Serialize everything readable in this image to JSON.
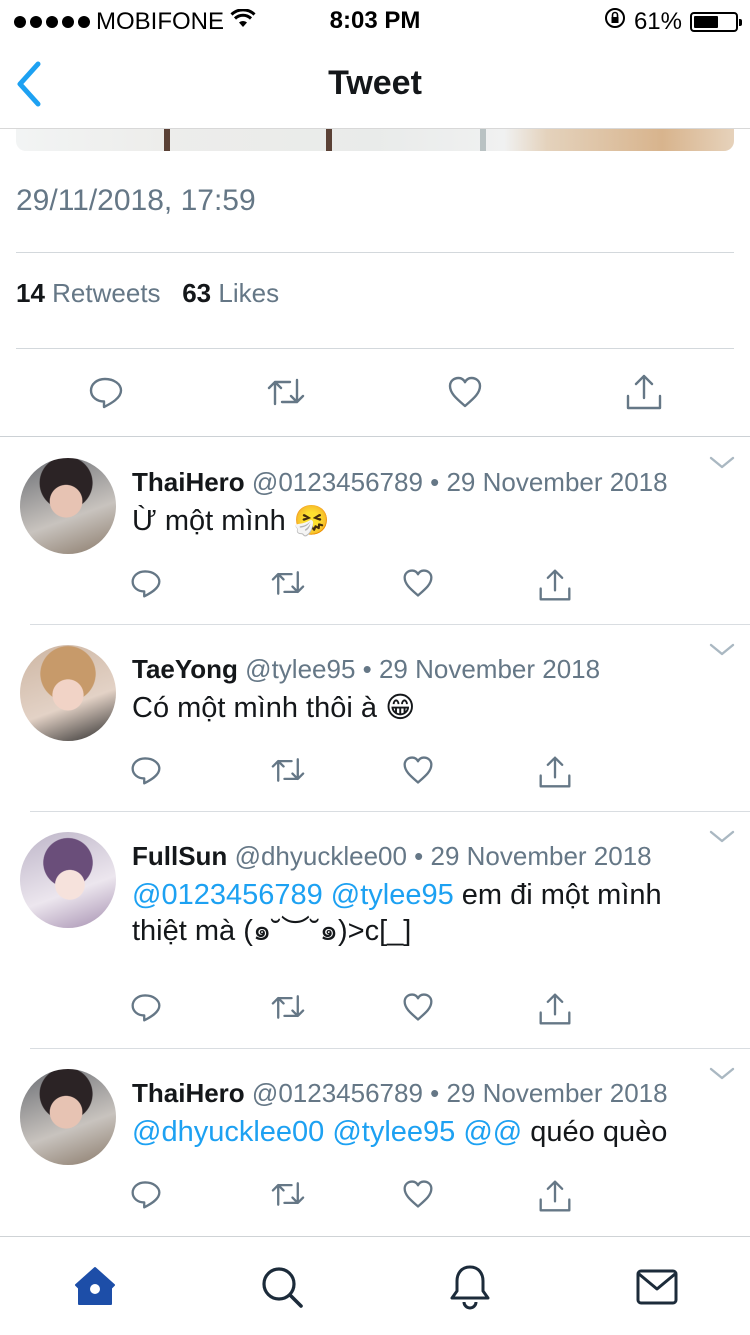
{
  "status": {
    "carrier": "MOBIFONE",
    "time": "8:03 PM",
    "battery": "61%",
    "battery_level": 0.61
  },
  "nav": {
    "title": "Tweet"
  },
  "tweet": {
    "datetime": "29/11/2018, 17:59",
    "retweets_count": "14",
    "retweets_label": "Retweets",
    "likes_count": "63",
    "likes_label": "Likes"
  },
  "replies": [
    {
      "name": "ThaiHero",
      "meta": "@0123456789 • 29 November 2018",
      "text": "Ừ một mình",
      "emoji": "🤧"
    },
    {
      "name": "TaeYong",
      "meta": "@tylee95 • 29 November 2018",
      "text": "Có một mình thôi à",
      "emoji": "😁"
    },
    {
      "name": "FullSun",
      "meta": "@dhyucklee00 • 29 November 2018",
      "mentions": "@0123456789 @tylee95",
      "text": " em đi một mình thiệt mà (๑˘︶˘๑)>c[_]"
    },
    {
      "name": "ThaiHero",
      "meta": "@0123456789 • 29 November 2018",
      "mentions": "@dhyucklee00 @tylee95 @@",
      "text": " quéo quèo"
    }
  ],
  "icons": {
    "reply": "reply-icon",
    "retweet": "retweet-icon",
    "like": "heart-icon",
    "share": "share-icon",
    "chevron": "chevron-down-icon",
    "home": "home-icon",
    "search": "search-icon",
    "notifications": "bell-icon",
    "messages": "mail-icon"
  },
  "colors": {
    "accent": "#1da1f2",
    "muted": "#657786",
    "text": "#14171a",
    "tab_active": "#1d4ea8",
    "tab_inactive": "#1c2b3a"
  }
}
